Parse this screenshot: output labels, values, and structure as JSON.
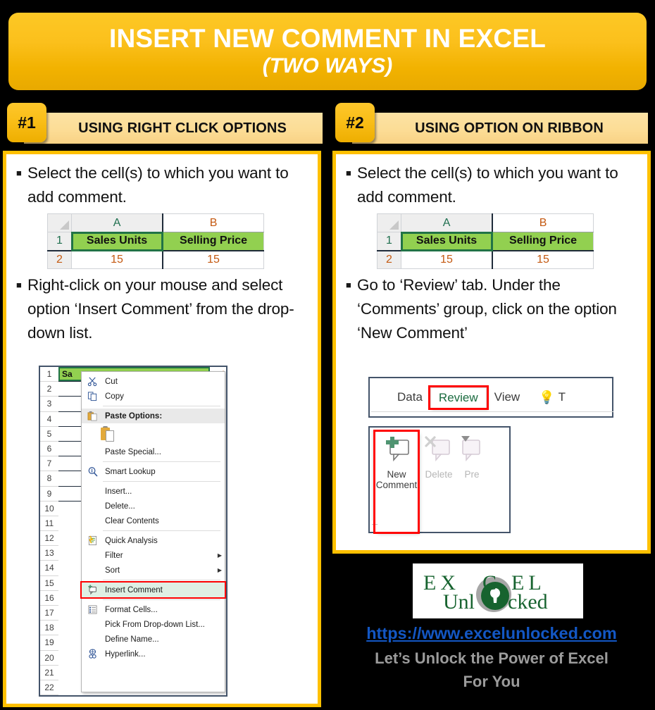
{
  "title": {
    "main": "INSERT NEW COMMENT IN EXCEL",
    "sub": "(TWO WAYS)"
  },
  "sections": [
    {
      "badge": "#1",
      "heading": "USING RIGHT CLICK OPTIONS"
    },
    {
      "badge": "#2",
      "heading": "USING OPTION ON RIBBON"
    }
  ],
  "method1": {
    "steps": [
      "Select the cell(s) to which you want to add comment.",
      "Right-click on your mouse and select option ‘Insert Comment’ from the drop-down list."
    ]
  },
  "method2": {
    "steps": [
      "Select the cell(s) to which you want to add comment.",
      "Go to ‘Review’ tab. Under the ‘Comments’ group, click on the option ‘New Comment’"
    ]
  },
  "spreadsheet": {
    "column_headers": [
      "A",
      "B"
    ],
    "row_headers": [
      "1",
      "2"
    ],
    "rows": [
      [
        "Sales Units",
        "Selling Price"
      ],
      [
        "15",
        "15"
      ]
    ],
    "selected_cell": "A1",
    "highlight_color": "#92d050",
    "selection_border_color": "#217346"
  },
  "context_menu": {
    "row_numbers": [
      "1",
      "2",
      "3",
      "4",
      "5",
      "6",
      "7",
      "8",
      "9",
      "10",
      "11",
      "12",
      "13",
      "14",
      "15",
      "16",
      "17",
      "18",
      "19",
      "20",
      "21",
      "22"
    ],
    "cell_a1_text": "Sa",
    "items": [
      {
        "label": "Cut",
        "icon": "scissors-icon",
        "type": "item"
      },
      {
        "label": "Copy",
        "icon": "copy-icon",
        "type": "item"
      },
      {
        "label": "Paste Options:",
        "icon": "paste-icon",
        "type": "header"
      },
      {
        "label": "",
        "icon": "clipboard-icon",
        "type": "paste-gallery"
      },
      {
        "label": "Paste Special...",
        "icon": "",
        "type": "item"
      },
      {
        "label": "Smart Lookup",
        "icon": "lookup-icon",
        "type": "item"
      },
      {
        "label": "Insert...",
        "icon": "",
        "type": "item"
      },
      {
        "label": "Delete...",
        "icon": "",
        "type": "item"
      },
      {
        "label": "Clear Contents",
        "icon": "",
        "type": "item"
      },
      {
        "label": "Quick Analysis",
        "icon": "quick-analysis-icon",
        "type": "item"
      },
      {
        "label": "Filter",
        "icon": "",
        "type": "submenu"
      },
      {
        "label": "Sort",
        "icon": "",
        "type": "submenu"
      },
      {
        "label": "Insert Comment",
        "icon": "comment-icon",
        "type": "selected"
      },
      {
        "label": "Format Cells...",
        "icon": "format-cells-icon",
        "type": "item"
      },
      {
        "label": "Pick From Drop-down List...",
        "icon": "",
        "type": "item"
      },
      {
        "label": "Define Name...",
        "icon": "",
        "type": "item"
      },
      {
        "label": "Hyperlink...",
        "icon": "hyperlink-icon",
        "type": "item"
      }
    ],
    "highlight_color": "#ff0000"
  },
  "ribbon": {
    "tabs": [
      {
        "label": "Data",
        "active": false
      },
      {
        "label": "Review",
        "active": true
      },
      {
        "label": "View",
        "active": false
      }
    ],
    "tell_me_icon": "lightbulb-icon",
    "tell_me_partial": "T",
    "buttons": [
      {
        "label": "New\nComment",
        "line1": "New",
        "line2": "Comment",
        "highlighted": true,
        "enabled": true
      },
      {
        "label": "Delete",
        "line1": "Delete",
        "line2": "",
        "highlighted": false,
        "enabled": false
      },
      {
        "label": "Pre",
        "line1": "Pre",
        "line2": "",
        "highlighted": false,
        "enabled": false
      }
    ],
    "highlight_color": "#ff0000",
    "active_tab_color": "#1a6b3f"
  },
  "footer": {
    "logo_word1": "EXCEL",
    "logo_word2": "Unlocked",
    "logo_color": "#17632f",
    "url": "https://www.excelunlocked.com",
    "url_color": "#1357c4",
    "tagline_line1": "Let’s Unlock the Power of Excel",
    "tagline_line2": "For You",
    "tagline_color": "#9b9b9b"
  },
  "theme": {
    "background": "#000000",
    "accent": "#FFC000",
    "banner_gradient_top": "#fdc825",
    "banner_gradient_bottom": "#e8a900",
    "header_bar": "#fcdd96"
  }
}
